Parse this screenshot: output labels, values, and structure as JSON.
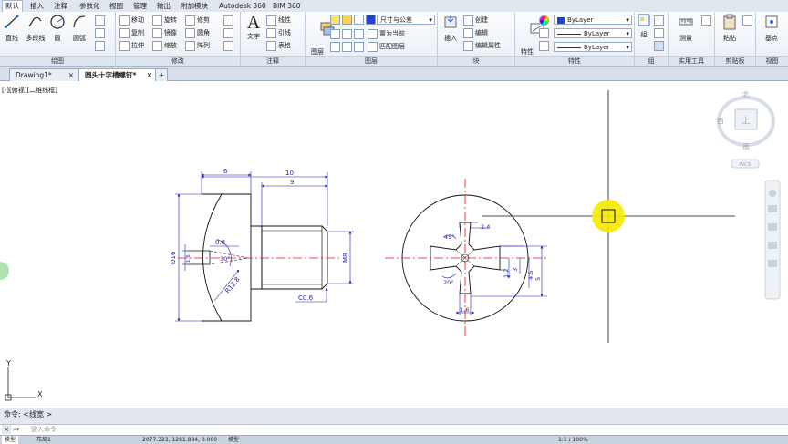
{
  "ribbon_tabs": [
    "默认",
    "插入",
    "注释",
    "参数化",
    "视图",
    "管理",
    "输出",
    "附加模块",
    "Autodesk 360",
    "BIM 360"
  ],
  "panels": {
    "draw": {
      "title": "绘图",
      "line": "直线",
      "polyline": "多段线",
      "circle": "圆",
      "arc": "圆弧"
    },
    "modify": {
      "title": "修改",
      "move": "移动",
      "rotate": "旋转",
      "trim": "修剪",
      "copy": "复制",
      "mirror": "镜像",
      "fillet": "圆角",
      "stretch": "拉伸",
      "scale": "缩放",
      "array": "阵列"
    },
    "annotation": {
      "title": "注释",
      "text": "文字",
      "linear": "线性",
      "leader": "引线",
      "table": "表格"
    },
    "layers": {
      "title": "图层",
      "props": "图层\n特性",
      "layer_name": "尺寸与公差",
      "set_current": "置为当前",
      "match_layer": "匹配图层"
    },
    "block": {
      "title": "块",
      "insert": "插入",
      "create": "创建",
      "edit": "编辑",
      "edit_attr": "编辑属性"
    },
    "properties": {
      "title": "特性",
      "match": "特性\n匹配",
      "color": "ByLayer",
      "linetype": "ByLayer",
      "lineweight": "ByLayer"
    },
    "groups": {
      "title": "组",
      "group": "组"
    },
    "utilities": {
      "title": "实用工具",
      "measure": "测量"
    },
    "clipboard": {
      "title": "剪贴板",
      "paste": "粘贴"
    },
    "view": {
      "title": "视图",
      "base": "基点"
    }
  },
  "doc_tabs": [
    "Drawing1*",
    "圆头十字槽螺钉*"
  ],
  "view_label": "[-][俯视][二维线框]",
  "viewcube": {
    "north": "北",
    "south": "南",
    "west": "西",
    "top": "上",
    "wcs": "WCS"
  },
  "ucs": {
    "x": "X",
    "y": "Y"
  },
  "dims": {
    "d6": "6",
    "d10": "10",
    "d9": "9",
    "phi16": "Ø16",
    "d0_8": "0.8",
    "a30": "30°",
    "r12_8": "R12.8",
    "c0_6": "C0.6",
    "m8": "M8",
    "d2_4": "2.4",
    "a45": "45°",
    "a20": "20°",
    "d1_2": "1.2",
    "d3": "3",
    "d4_5": "4.5",
    "d5": "5",
    "d1_6": "1.6",
    "d1_6b": "1.6"
  },
  "command": {
    "history": "命令:  <线宽 >",
    "prompt": "键入命令"
  },
  "status": {
    "coords": "2077.323, 1281.884, 0.000",
    "model": "模型",
    "layout1": "布局1",
    "scale": "1:1 / 100%"
  }
}
